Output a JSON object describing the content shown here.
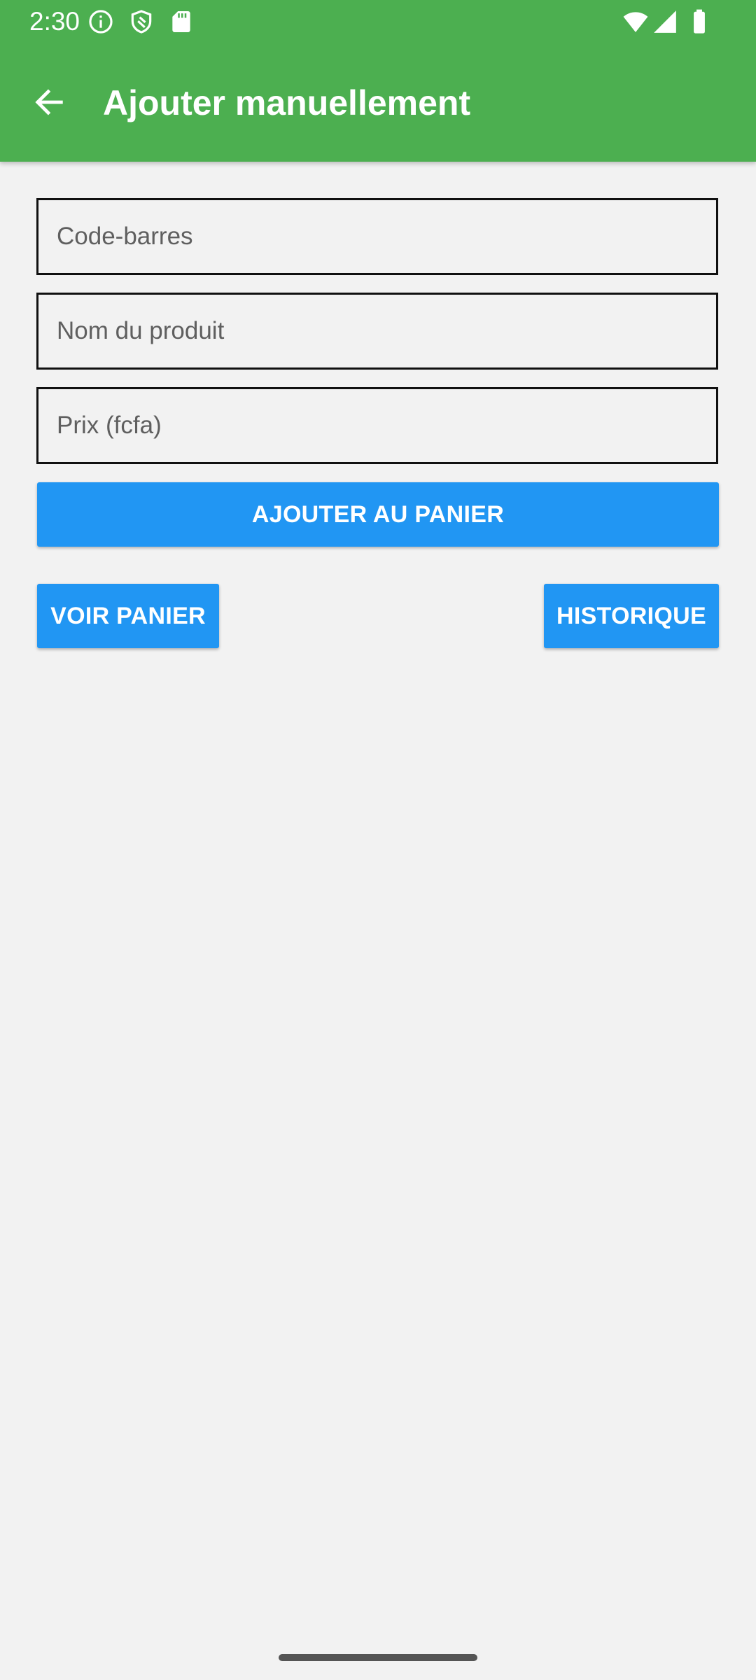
{
  "status_bar": {
    "time": "2:30",
    "icons": [
      "info-icon",
      "shield-icon",
      "sd-card-icon",
      "wifi-icon",
      "cell-signal-icon",
      "battery-icon"
    ]
  },
  "app_bar": {
    "back_icon": "arrow-left-icon",
    "title": "Ajouter manuellement",
    "background_color": "#4caf50"
  },
  "form": {
    "barcode_placeholder": "Code-barres",
    "barcode_value": "",
    "product_name_placeholder": "Nom du produit",
    "product_name_value": "",
    "price_placeholder": "Prix (fcfa)",
    "price_value": ""
  },
  "buttons": {
    "add_to_cart": "AJOUTER AU PANIER",
    "view_cart": "VOIR PANIER",
    "history": "HISTORIQUE",
    "color": "#2196f3"
  }
}
